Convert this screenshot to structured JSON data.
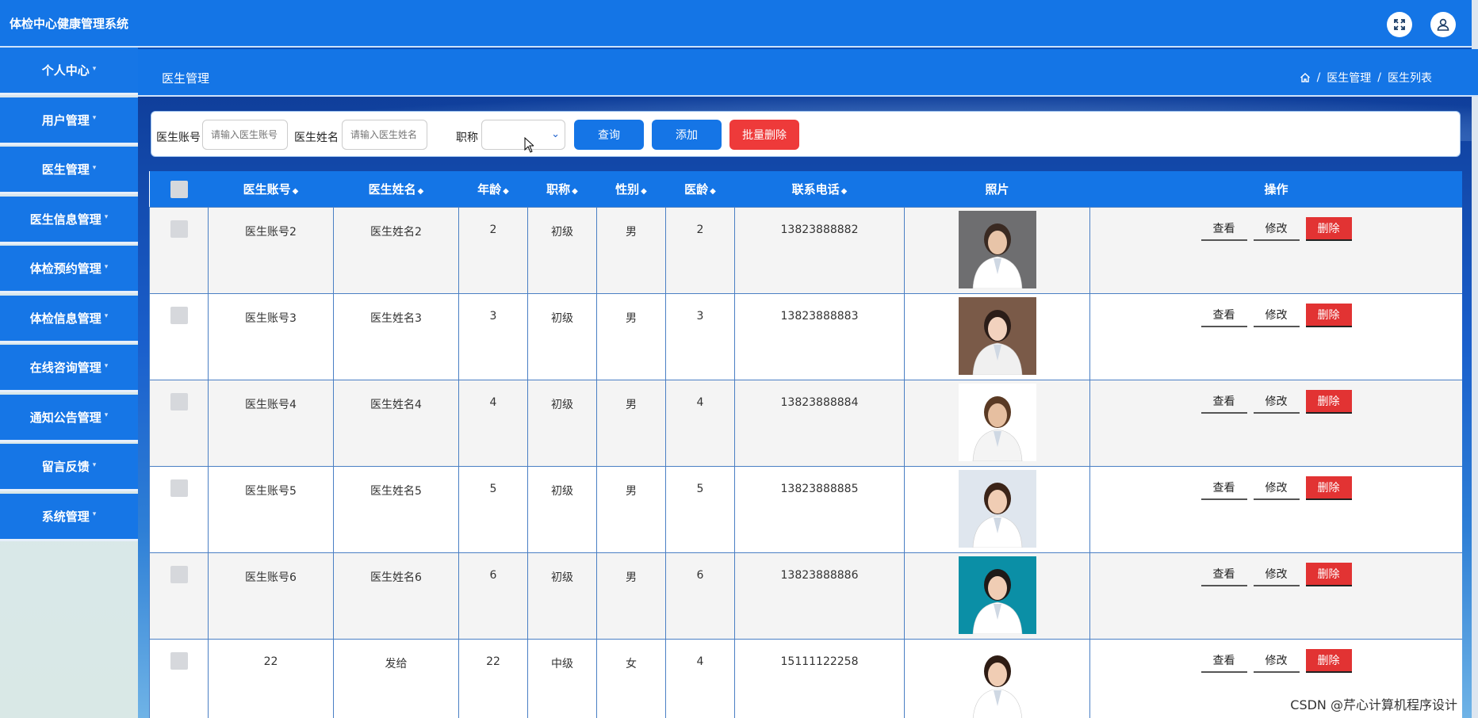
{
  "app": {
    "title": "体检中心健康管理系统"
  },
  "header_icons": [
    "fullscreen-icon",
    "user-icon"
  ],
  "sidebar": {
    "items": [
      {
        "label": "个人中心"
      },
      {
        "label": "用户管理"
      },
      {
        "label": "医生管理"
      },
      {
        "label": "医生信息管理"
      },
      {
        "label": "体检预约管理"
      },
      {
        "label": "体检信息管理"
      },
      {
        "label": "在线咨询管理"
      },
      {
        "label": "通知公告管理"
      },
      {
        "label": "留言反馈"
      },
      {
        "label": "系统管理"
      }
    ]
  },
  "page": {
    "title": "医生管理"
  },
  "breadcrumb": {
    "sep": "/",
    "items": [
      "医生管理",
      "医生列表"
    ]
  },
  "search": {
    "account_label": "医生账号",
    "account_placeholder": "请输入医生账号",
    "name_label": "医生姓名",
    "name_placeholder": "请输入医生姓名",
    "title_label": "职称",
    "title_value": "",
    "query_label": "查询",
    "add_label": "添加",
    "batch_delete_label": "批量删除"
  },
  "table": {
    "headers": {
      "account": "医生账号",
      "name": "医生姓名",
      "age": "年龄",
      "title": "职称",
      "gender": "性别",
      "years": "医龄",
      "phone": "联系电话",
      "photo": "照片",
      "ops": "操作"
    },
    "rows": [
      {
        "account": "医生账号2",
        "name": "医生姓名2",
        "age": "2",
        "title": "初级",
        "gender": "男",
        "years": "2",
        "phone": "13823888882",
        "photo": {
          "bg": "#6e6e70",
          "coat": "#ffffff",
          "hair": "#3a2a22",
          "skin": "#e8c4a8"
        }
      },
      {
        "account": "医生账号3",
        "name": "医生姓名3",
        "age": "3",
        "title": "初级",
        "gender": "男",
        "years": "3",
        "phone": "13823888883",
        "photo": {
          "bg": "#7a5a48",
          "coat": "#f0f0f0",
          "hair": "#2b1d18",
          "skin": "#f2d2be"
        }
      },
      {
        "account": "医生账号4",
        "name": "医生姓名4",
        "age": "4",
        "title": "初级",
        "gender": "男",
        "years": "4",
        "phone": "13823888884",
        "photo": {
          "bg": "#ffffff",
          "coat": "#f4f4f4",
          "hair": "#5a3a24",
          "skin": "#e6bfa0"
        }
      },
      {
        "account": "医生账号5",
        "name": "医生姓名5",
        "age": "5",
        "title": "初级",
        "gender": "男",
        "years": "5",
        "phone": "13823888885",
        "photo": {
          "bg": "#dfe6ee",
          "coat": "#ffffff",
          "hair": "#3b2418",
          "skin": "#f0cdb4"
        }
      },
      {
        "account": "医生账号6",
        "name": "医生姓名6",
        "age": "6",
        "title": "初级",
        "gender": "男",
        "years": "6",
        "phone": "13823888886",
        "photo": {
          "bg": "#0b8fa6",
          "coat": "#ffffff",
          "hair": "#1e1a18",
          "skin": "#f0cdb4"
        }
      },
      {
        "account": "22",
        "name": "发给",
        "age": "22",
        "title": "中级",
        "gender": "女",
        "years": "4",
        "phone": "15111122258",
        "photo": {
          "bg": "#ffffff",
          "coat": "#ffffff",
          "hair": "#2e1c14",
          "skin": "#f0cdb4"
        }
      }
    ],
    "ops": {
      "view": "查看",
      "edit": "修改",
      "delete": "删除"
    }
  },
  "watermark": "CSDN @芹心计算机程序设计"
}
